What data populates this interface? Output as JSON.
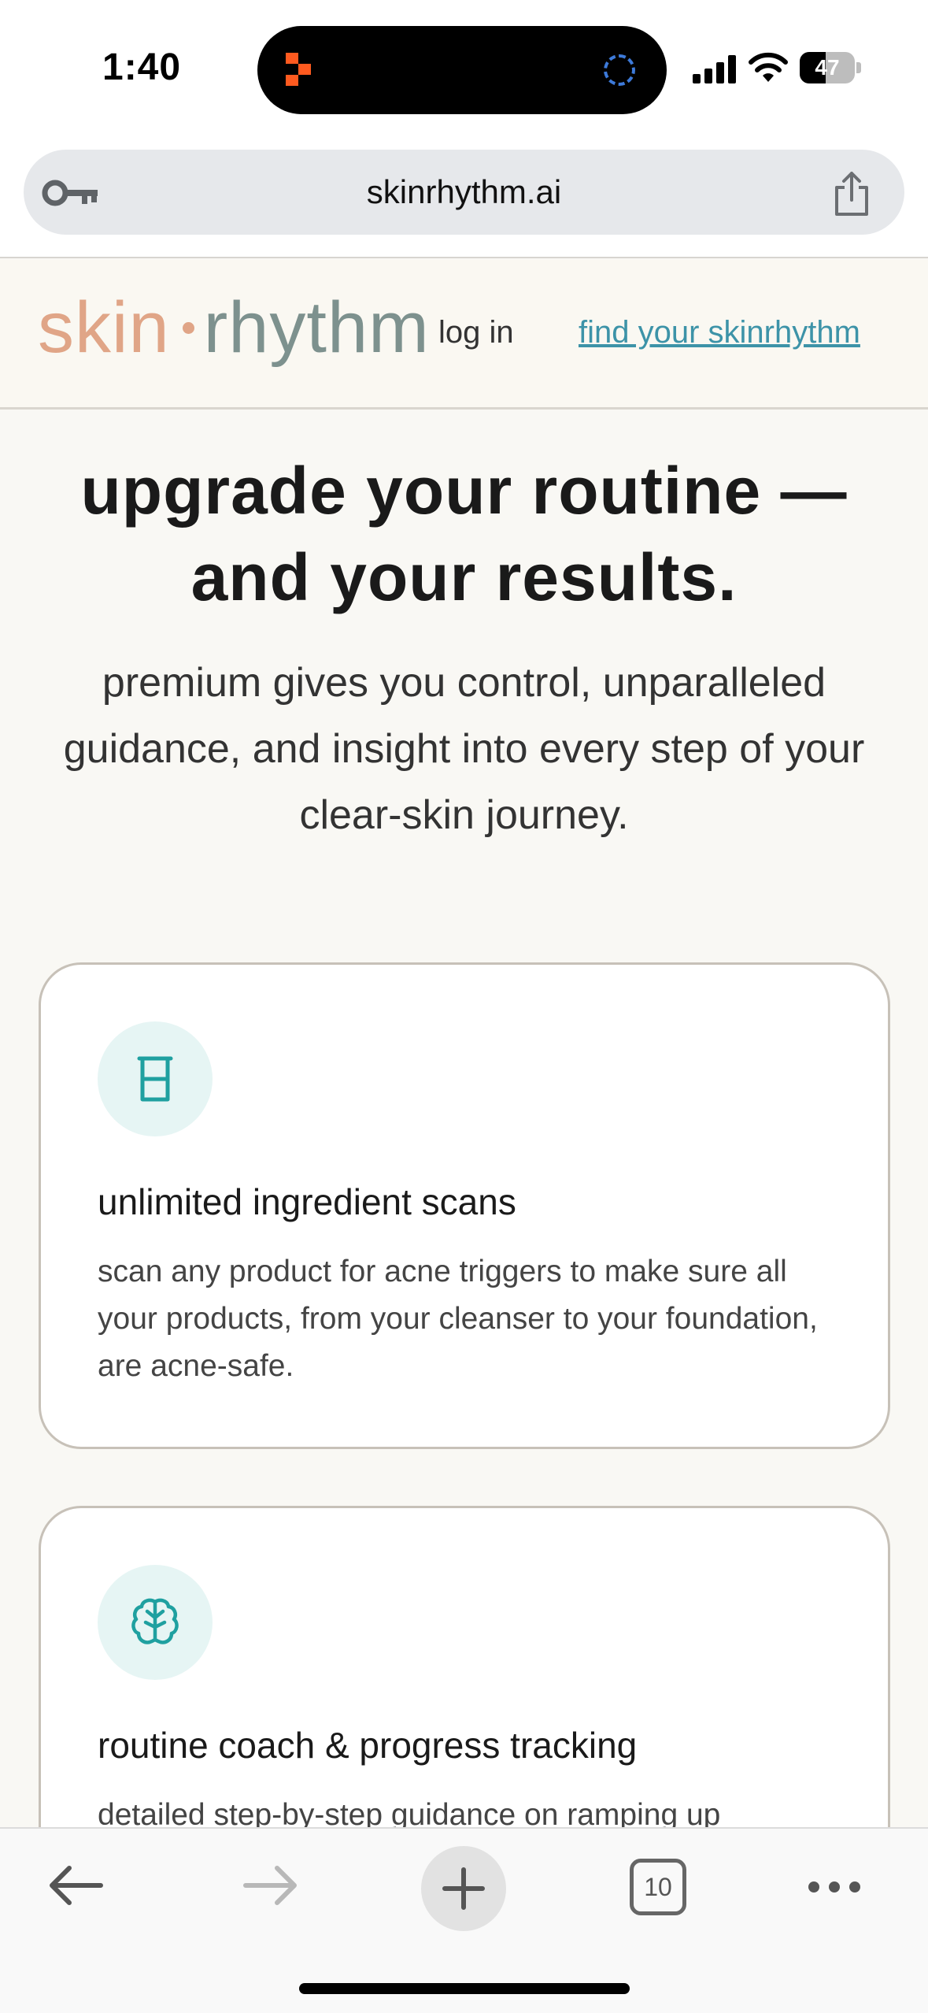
{
  "status_bar": {
    "time": "1:40",
    "battery": "47",
    "battery_level_pct": 47
  },
  "browser": {
    "url": "skinrhythm.ai",
    "tab_count": "10"
  },
  "site_header": {
    "logo_part_a": "skin",
    "logo_part_b": "rhythm",
    "login_label": "log in",
    "cta_label": "find your skinrhythm"
  },
  "hero": {
    "title_line1": "upgrade your routine —",
    "title_line2": "and your results.",
    "subtitle": "premium gives you control, unparalleled guidance, and insight into every step of your clear-skin journey."
  },
  "features": [
    {
      "icon": "beaker-icon",
      "title": "unlimited ingredient scans",
      "description": "scan any product for acne triggers to make sure all your products, from your cleanser to your foundation, are acne-safe."
    },
    {
      "icon": "brain-icon",
      "title": "routine coach & progress tracking",
      "description": "detailed step-by-step guidance on ramping up"
    }
  ],
  "colors": {
    "logo_peach": "#e0a587",
    "logo_sage": "#7d918e",
    "link_teal": "#3d93a8",
    "icon_teal": "#1fa0a0",
    "icon_bg": "#e6f5f4",
    "page_bg": "#f9f8f4"
  }
}
